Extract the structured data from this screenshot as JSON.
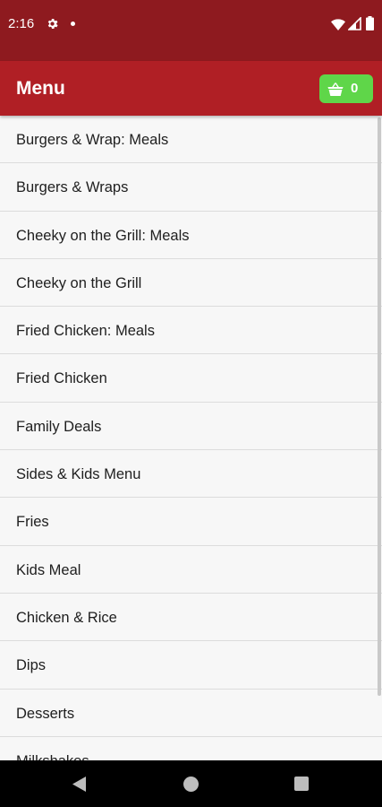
{
  "status_bar": {
    "time": "2:16",
    "icons": [
      "gear-icon",
      "notification-dot",
      "wifi-icon",
      "signal-icon",
      "battery-icon"
    ]
  },
  "app_bar": {
    "title": "Menu",
    "cart": {
      "icon": "shopping-basket-icon",
      "count": "0"
    }
  },
  "menu": {
    "items": [
      {
        "label": "Burgers & Wrap: Meals"
      },
      {
        "label": "Burgers & Wraps"
      },
      {
        "label": "Cheeky on the Grill: Meals"
      },
      {
        "label": "Cheeky on the Grill"
      },
      {
        "label": "Fried Chicken: Meals"
      },
      {
        "label": "Fried Chicken"
      },
      {
        "label": "Family Deals"
      },
      {
        "label": "Sides & Kids Menu"
      },
      {
        "label": "Fries"
      },
      {
        "label": "Kids Meal"
      },
      {
        "label": "Chicken & Rice"
      },
      {
        "label": "Dips"
      },
      {
        "label": "Desserts"
      },
      {
        "label": "Milkshakes"
      }
    ]
  },
  "nav_bar": {
    "icons": [
      "back-icon",
      "home-icon",
      "recents-icon"
    ]
  },
  "colors": {
    "status_bar": "#8e1a1f",
    "app_bar": "#b01f25",
    "cart_button": "#5fd649",
    "list_background": "#f7f7f7",
    "divider": "#dcdcdc",
    "nav_bar": "#000000"
  }
}
